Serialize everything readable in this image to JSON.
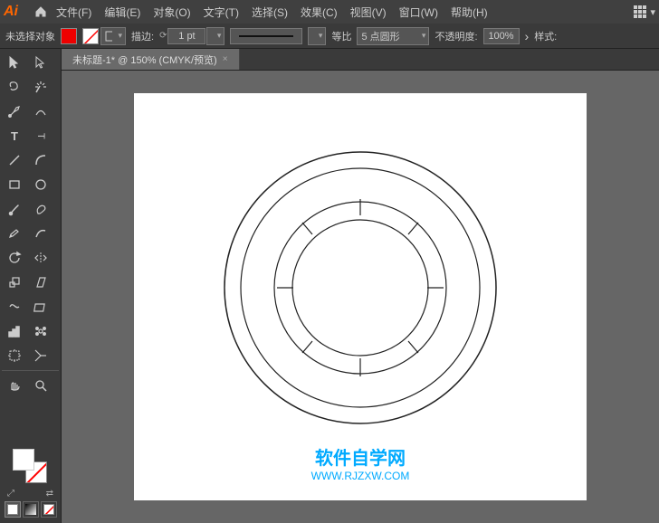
{
  "app": {
    "logo": "Ai",
    "title": "未标题-1* @ 150% (CMYK/预览)"
  },
  "menu": {
    "items": [
      "文件(F)",
      "编辑(E)",
      "对象(O)",
      "文字(T)",
      "选择(S)",
      "效果(C)",
      "视图(V)",
      "窗口(W)",
      "帮助(H)"
    ]
  },
  "options_bar": {
    "no_selection": "未选择对象",
    "stroke_label": "描边:",
    "stroke_value": "1 pt",
    "line_label": "等比",
    "points_label": "5 点圆形",
    "opacity_label": "不透明度:",
    "opacity_value": "100%",
    "style_label": "样式:"
  },
  "tab": {
    "label": "未标题-1* @ 150% (CMYK/预览)",
    "close": "×"
  },
  "watermark": {
    "main": "软件自学网",
    "sub": "WWW.RJZXW.COM"
  },
  "tools": [
    {
      "name": "selection",
      "icon": "arrow"
    },
    {
      "name": "direct-selection",
      "icon": "direct-arrow"
    },
    {
      "name": "lasso",
      "icon": "lasso"
    },
    {
      "name": "pen",
      "icon": "pen"
    },
    {
      "name": "type",
      "icon": "T"
    },
    {
      "name": "line",
      "icon": "line"
    },
    {
      "name": "shape",
      "icon": "rect"
    },
    {
      "name": "paintbrush",
      "icon": "brush"
    },
    {
      "name": "pencil",
      "icon": "pencil"
    },
    {
      "name": "rotate",
      "icon": "rotate"
    },
    {
      "name": "mirror",
      "icon": "mirror"
    },
    {
      "name": "scale",
      "icon": "scale"
    },
    {
      "name": "warp",
      "icon": "warp"
    },
    {
      "name": "graph",
      "icon": "graph"
    },
    {
      "name": "artboard",
      "icon": "artboard"
    },
    {
      "name": "slice",
      "icon": "slice"
    },
    {
      "name": "hand",
      "icon": "hand"
    },
    {
      "name": "zoom",
      "icon": "zoom"
    }
  ],
  "colors": {
    "accent": "#00aaff",
    "bg": "#3a3a3a",
    "canvas_bg": "#666666",
    "white": "#ffffff"
  }
}
